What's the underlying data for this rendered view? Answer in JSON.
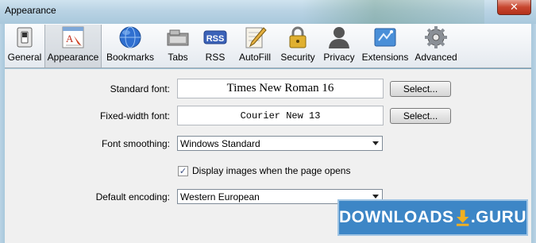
{
  "window": {
    "title": "Appearance",
    "close_symbol": "✕"
  },
  "toolbar": {
    "items": [
      {
        "label": "General",
        "icon": "general-switch-icon"
      },
      {
        "label": "Appearance",
        "icon": "appearance-icon",
        "selected": true
      },
      {
        "label": "Bookmarks",
        "icon": "globe-icon"
      },
      {
        "label": "Tabs",
        "icon": "tabs-icon"
      },
      {
        "label": "RSS",
        "icon": "rss-icon",
        "badge": "RSS"
      },
      {
        "label": "AutoFill",
        "icon": "autofill-pencil-icon"
      },
      {
        "label": "Security",
        "icon": "lock-icon"
      },
      {
        "label": "Privacy",
        "icon": "person-silhouette-icon"
      },
      {
        "label": "Extensions",
        "icon": "extensions-icon"
      },
      {
        "label": "Advanced",
        "icon": "gear-icon"
      }
    ]
  },
  "form": {
    "standard_font": {
      "label": "Standard font:",
      "value": "Times New Roman 16",
      "button": "Select..."
    },
    "fixed_font": {
      "label": "Fixed-width font:",
      "value": "Courier New 13",
      "button": "Select..."
    },
    "smoothing": {
      "label": "Font smoothing:",
      "value": "Windows Standard"
    },
    "display_images": {
      "label": "Display images when the page opens",
      "checked": true,
      "check_symbol": "✓"
    },
    "encoding": {
      "label": "Default encoding:",
      "value": "Western European"
    }
  },
  "watermark": {
    "text_left": "DOWNLOADS",
    "text_right": ".GURU",
    "colors": {
      "bg": "#3d86c6",
      "arrow": "#f2b020"
    }
  }
}
